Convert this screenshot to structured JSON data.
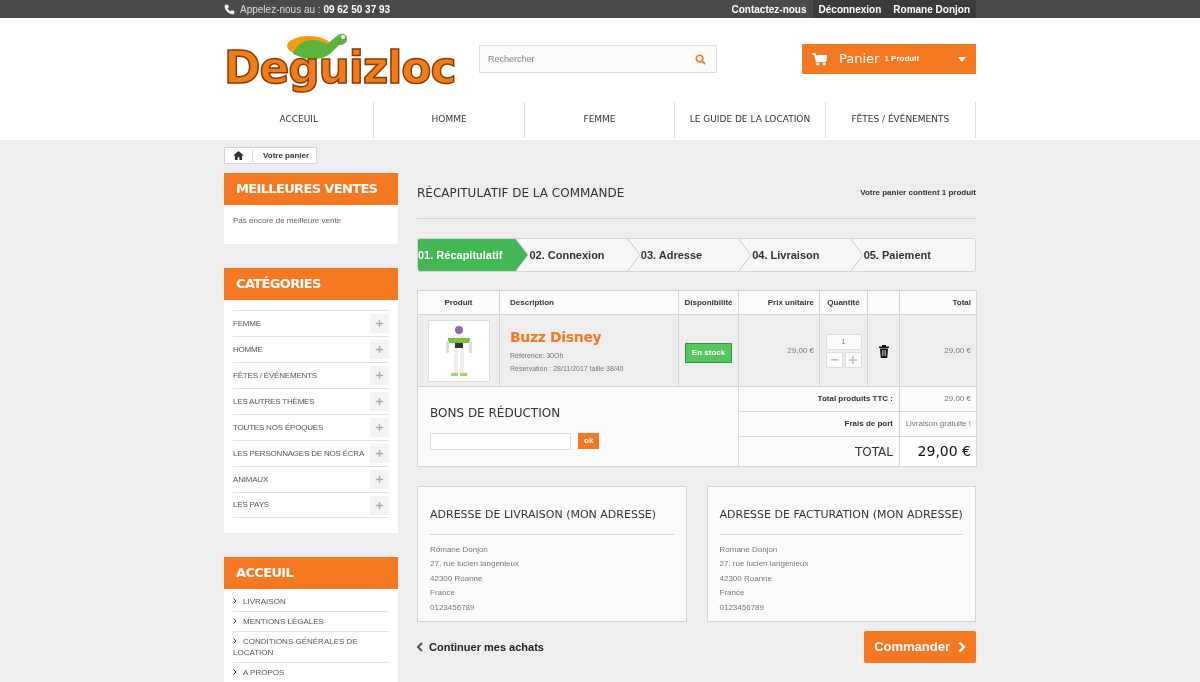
{
  "top_bar": {
    "phone_label": "Appelez-nous au :",
    "phone": "09 62 50 37 93",
    "links": [
      "Contactez-nous",
      "Déconnexion",
      "Romane Donjon"
    ]
  },
  "header": {
    "logo": "Deguizloc",
    "search_placeholder": "Rechercher",
    "cart": {
      "label": "Panier",
      "count": "1 Produit"
    }
  },
  "nav": [
    "ACCEUIL",
    "HOMME",
    "FEMME",
    "LE GUIDE DE LA LOCATION",
    "FÊTES / ÉVÉNEMENTS"
  ],
  "breadcrumb": [
    "Votre panier"
  ],
  "sidebar": [
    {
      "kind": "text",
      "title": "MEILLEURES VENTES",
      "text": "Pas encore de meilleure vente"
    },
    {
      "kind": "categories",
      "title": "CATÉGORIES",
      "items": [
        "FEMME",
        "HOMME",
        "FÊTES / ÉVÉNEMENTS",
        "LES AUTRES THÈMES",
        "TOUTES NOS ÉPOQUES",
        "LES PERSONNAGES DE NOS ÉCRA",
        "ANIMAUX",
        "LES PAYS"
      ]
    },
    {
      "kind": "links",
      "title": "ACCEUIL",
      "items": [
        "LIVRAISON",
        "MENTIONS LÉGALES",
        "CONDITIONS GÉNÉRALES DE LOCATION",
        "A PROPOS"
      ]
    }
  ],
  "main": {
    "title": "RÉCAPITULATIF DE LA COMMANDE",
    "summary": "Votre panier contient 1 produit",
    "steps": [
      {
        "label": "01. Récapitulatif",
        "selected": true
      },
      {
        "label": "02. Connexion",
        "selected": false
      },
      {
        "label": "03. Adresse",
        "selected": false
      },
      {
        "label": "04. Livraison",
        "selected": false
      },
      {
        "label": "05. Paiement",
        "selected": false
      }
    ],
    "table": {
      "columns": [
        "Produit",
        "Description",
        "Disponibilité",
        "Prix unitaire",
        "Quantité",
        "Total"
      ],
      "rows": [
        {
          "name": "Buzz Disney",
          "reference": "Référence: 30Oh",
          "reservation": "Réservation : 28/11/2017 taille 38/40",
          "availability": "En stock",
          "unit_price": "29,00 €",
          "quantity": "1",
          "total": "29,00 €"
        }
      ]
    },
    "voucher": {
      "title": "BONS DE RÉDUCTION",
      "button": "ok"
    },
    "totals": [
      {
        "label": "Total produits TTC :",
        "value": "29,00 €"
      },
      {
        "label": "Frais de port",
        "value": "Livraison gratuite !"
      }
    ],
    "grand_total": {
      "label": "TOTAL",
      "value": "29,00 €"
    },
    "addresses": [
      {
        "title": "ADRESSE DE LIVRAISON (MON ADRESSE)",
        "lines": [
          "Romane Donjon",
          "27, rue lucien langenieux",
          "42300 Roanne",
          "France",
          "0123456789"
        ]
      },
      {
        "title": "ADRESSE DE FACTURATION (MON ADRESSE)",
        "lines": [
          "Romane Donjon",
          "27, rue lucien langenieux",
          "42300 Roanne",
          "France",
          "0123456789"
        ]
      }
    ],
    "continue_link": "Continuer mes achats",
    "order_button": "Commander"
  }
}
